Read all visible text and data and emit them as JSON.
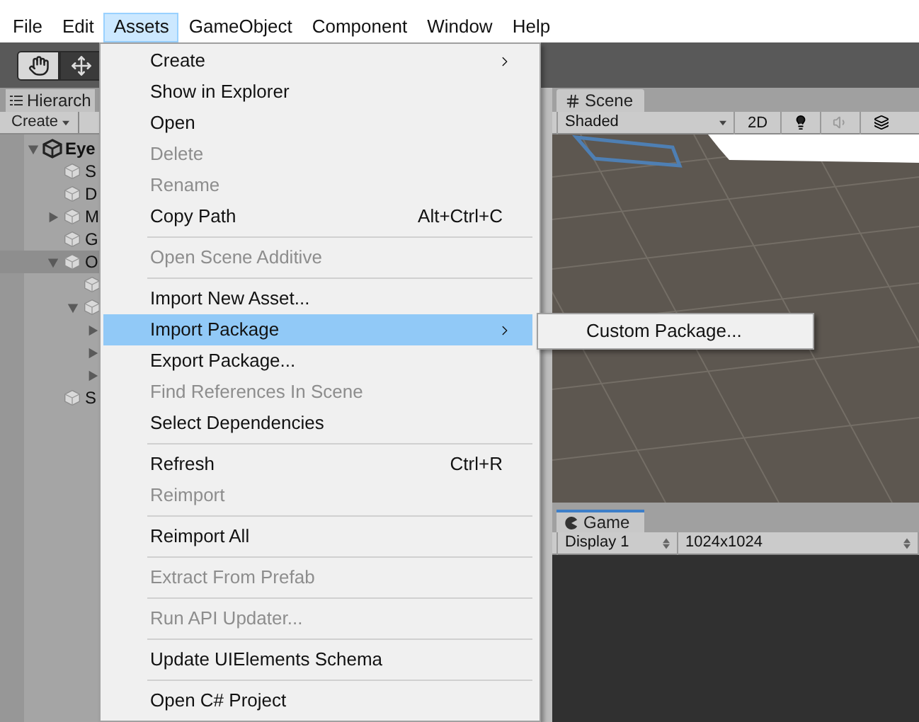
{
  "menubar": [
    {
      "label": "File",
      "selected": false
    },
    {
      "label": "Edit",
      "selected": false
    },
    {
      "label": "Assets",
      "selected": true
    },
    {
      "label": "GameObject",
      "selected": false
    },
    {
      "label": "Component",
      "selected": false
    },
    {
      "label": "Window",
      "selected": false
    },
    {
      "label": "Help",
      "selected": false
    }
  ],
  "toolbar": {
    "tools": [
      {
        "kind": "hand",
        "selected": true
      },
      {
        "kind": "move",
        "selected": false
      }
    ]
  },
  "hierarchy": {
    "tab": "Hierarch",
    "create_button": "Create",
    "tree": [
      {
        "kind": "scene",
        "label": "Eye",
        "expanded": true,
        "selected": false,
        "children": [
          {
            "kind": "leaf",
            "label": "S",
            "selected": false
          },
          {
            "kind": "leaf",
            "label": "D",
            "selected": false
          },
          {
            "kind": "group",
            "label": "M",
            "expanded": false,
            "selected": false
          },
          {
            "kind": "leaf",
            "label": "G",
            "selected": false
          },
          {
            "kind": "group",
            "label": "O",
            "expanded": true,
            "selected": true,
            "children": [
              {
                "kind": "leaf",
                "selected": false
              },
              {
                "kind": "group",
                "expanded": true,
                "selected": false,
                "children": [
                  {
                    "kind": "group",
                    "expanded": false,
                    "selected": false
                  },
                  {
                    "kind": "group",
                    "expanded": false,
                    "selected": false
                  },
                  {
                    "kind": "group",
                    "expanded": false,
                    "selected": false
                  }
                ]
              }
            ]
          },
          {
            "kind": "leaf",
            "label": "S",
            "selected": false
          }
        ]
      }
    ]
  },
  "menu": {
    "items": [
      {
        "kind": "item",
        "label": "Create",
        "disabled": false,
        "selected": false,
        "arrow": true
      },
      {
        "kind": "item",
        "label": "Show in Explorer",
        "disabled": false,
        "selected": false,
        "arrow": false
      },
      {
        "kind": "item",
        "label": "Open",
        "disabled": false,
        "selected": false,
        "arrow": false
      },
      {
        "kind": "item",
        "label": "Delete",
        "disabled": true,
        "selected": false,
        "arrow": false
      },
      {
        "kind": "item",
        "label": "Rename",
        "disabled": true,
        "selected": false,
        "arrow": false
      },
      {
        "kind": "item",
        "label": "Copy Path",
        "shortcut": "Alt+Ctrl+C",
        "disabled": false,
        "selected": false,
        "arrow": false
      },
      {
        "kind": "separator"
      },
      {
        "kind": "item",
        "label": "Open Scene Additive",
        "disabled": true,
        "selected": false,
        "arrow": false
      },
      {
        "kind": "separator"
      },
      {
        "kind": "item",
        "label": "Import New Asset...",
        "disabled": false,
        "selected": false,
        "arrow": false
      },
      {
        "kind": "item",
        "label": "Import Package",
        "disabled": false,
        "selected": true,
        "arrow": true,
        "submenu": [
          {
            "label": "Custom Package..."
          }
        ]
      },
      {
        "kind": "item",
        "label": "Export Package...",
        "disabled": false,
        "selected": false,
        "arrow": false
      },
      {
        "kind": "item",
        "label": "Find References In Scene",
        "disabled": true,
        "selected": false,
        "arrow": false
      },
      {
        "kind": "item",
        "label": "Select Dependencies",
        "disabled": false,
        "selected": false,
        "arrow": false
      },
      {
        "kind": "separator"
      },
      {
        "kind": "item",
        "label": "Refresh",
        "shortcut": "Ctrl+R",
        "disabled": false,
        "selected": false,
        "arrow": false
      },
      {
        "kind": "item",
        "label": "Reimport",
        "disabled": true,
        "selected": false,
        "arrow": false
      },
      {
        "kind": "separator"
      },
      {
        "kind": "item",
        "label": "Reimport All",
        "disabled": false,
        "selected": false,
        "arrow": false
      },
      {
        "kind": "separator"
      },
      {
        "kind": "item",
        "label": "Extract From Prefab",
        "disabled": true,
        "selected": false,
        "arrow": false
      },
      {
        "kind": "separator"
      },
      {
        "kind": "item",
        "label": "Run API Updater...",
        "disabled": true,
        "selected": false,
        "arrow": false
      },
      {
        "kind": "separator"
      },
      {
        "kind": "item",
        "label": "Update UIElements Schema",
        "disabled": false,
        "selected": false,
        "arrow": false
      },
      {
        "kind": "separator"
      },
      {
        "kind": "item",
        "label": "Open C# Project",
        "disabled": false,
        "selected": false,
        "arrow": false
      }
    ]
  },
  "scene": {
    "tab": "Scene",
    "shading": "Shaded",
    "mode_button": "2D"
  },
  "game": {
    "tab": "Game",
    "display": "Display 1",
    "resolution": "1024x1024"
  }
}
